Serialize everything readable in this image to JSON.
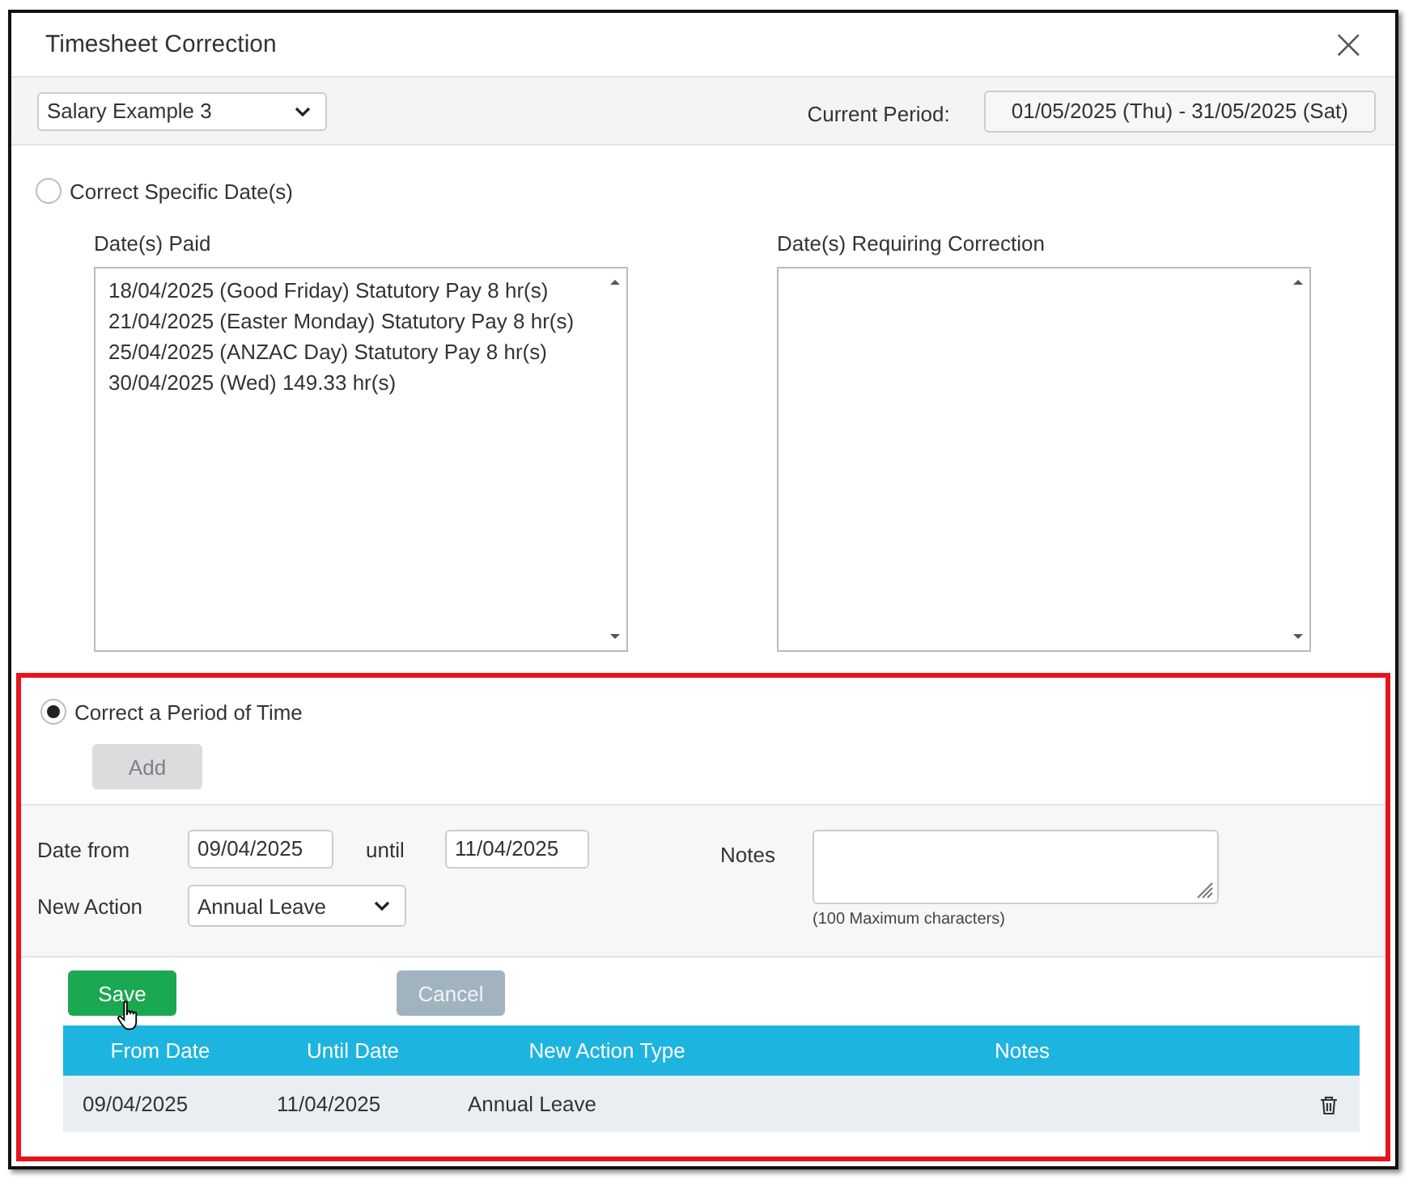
{
  "window": {
    "title": "Timesheet Correction",
    "close": "×"
  },
  "toolbar": {
    "employee": "Salary Example 3",
    "period_label": "Current Period:",
    "period": "01/05/2025 (Thu) - 31/05/2025 (Sat)"
  },
  "modes": [
    {
      "label": "Correct Specific Date(s)",
      "selected": false
    },
    {
      "label": "Correct a Period of Time",
      "selected": true
    }
  ],
  "dates_paid": {
    "label": "Date(s) Paid",
    "items": [
      "18/04/2025 (Good Friday) Statutory Pay 8 hr(s)",
      "21/04/2025 (Easter Monday) Statutory Pay 8 hr(s)",
      "25/04/2025 (ANZAC Day) Statutory Pay 8 hr(s)",
      "30/04/2025 (Wed) 149.33 hr(s)"
    ]
  },
  "dates_requiring": {
    "label": "Date(s) Requiring Correction"
  },
  "add_button": {
    "label": "Add",
    "disabled": true
  },
  "form": {
    "date_from_label": "Date from",
    "date_from": "09/04/2025",
    "until_label": "until",
    "until": "11/04/2025",
    "action_label": "New Action",
    "action": "Annual Leave",
    "notes_label": "Notes",
    "notes_hint": "(100 Maximum characters)"
  },
  "save": {
    "label": "Save"
  },
  "cancel": {
    "label": "Cancel",
    "disabled": true
  },
  "table": {
    "columns": [
      "From Date",
      "Until Date",
      "New Action Type",
      "Notes"
    ],
    "rows": [
      {
        "cells": [
          "09/04/2025",
          "11/04/2025",
          "Annual Leave",
          ""
        ]
      }
    ]
  }
}
